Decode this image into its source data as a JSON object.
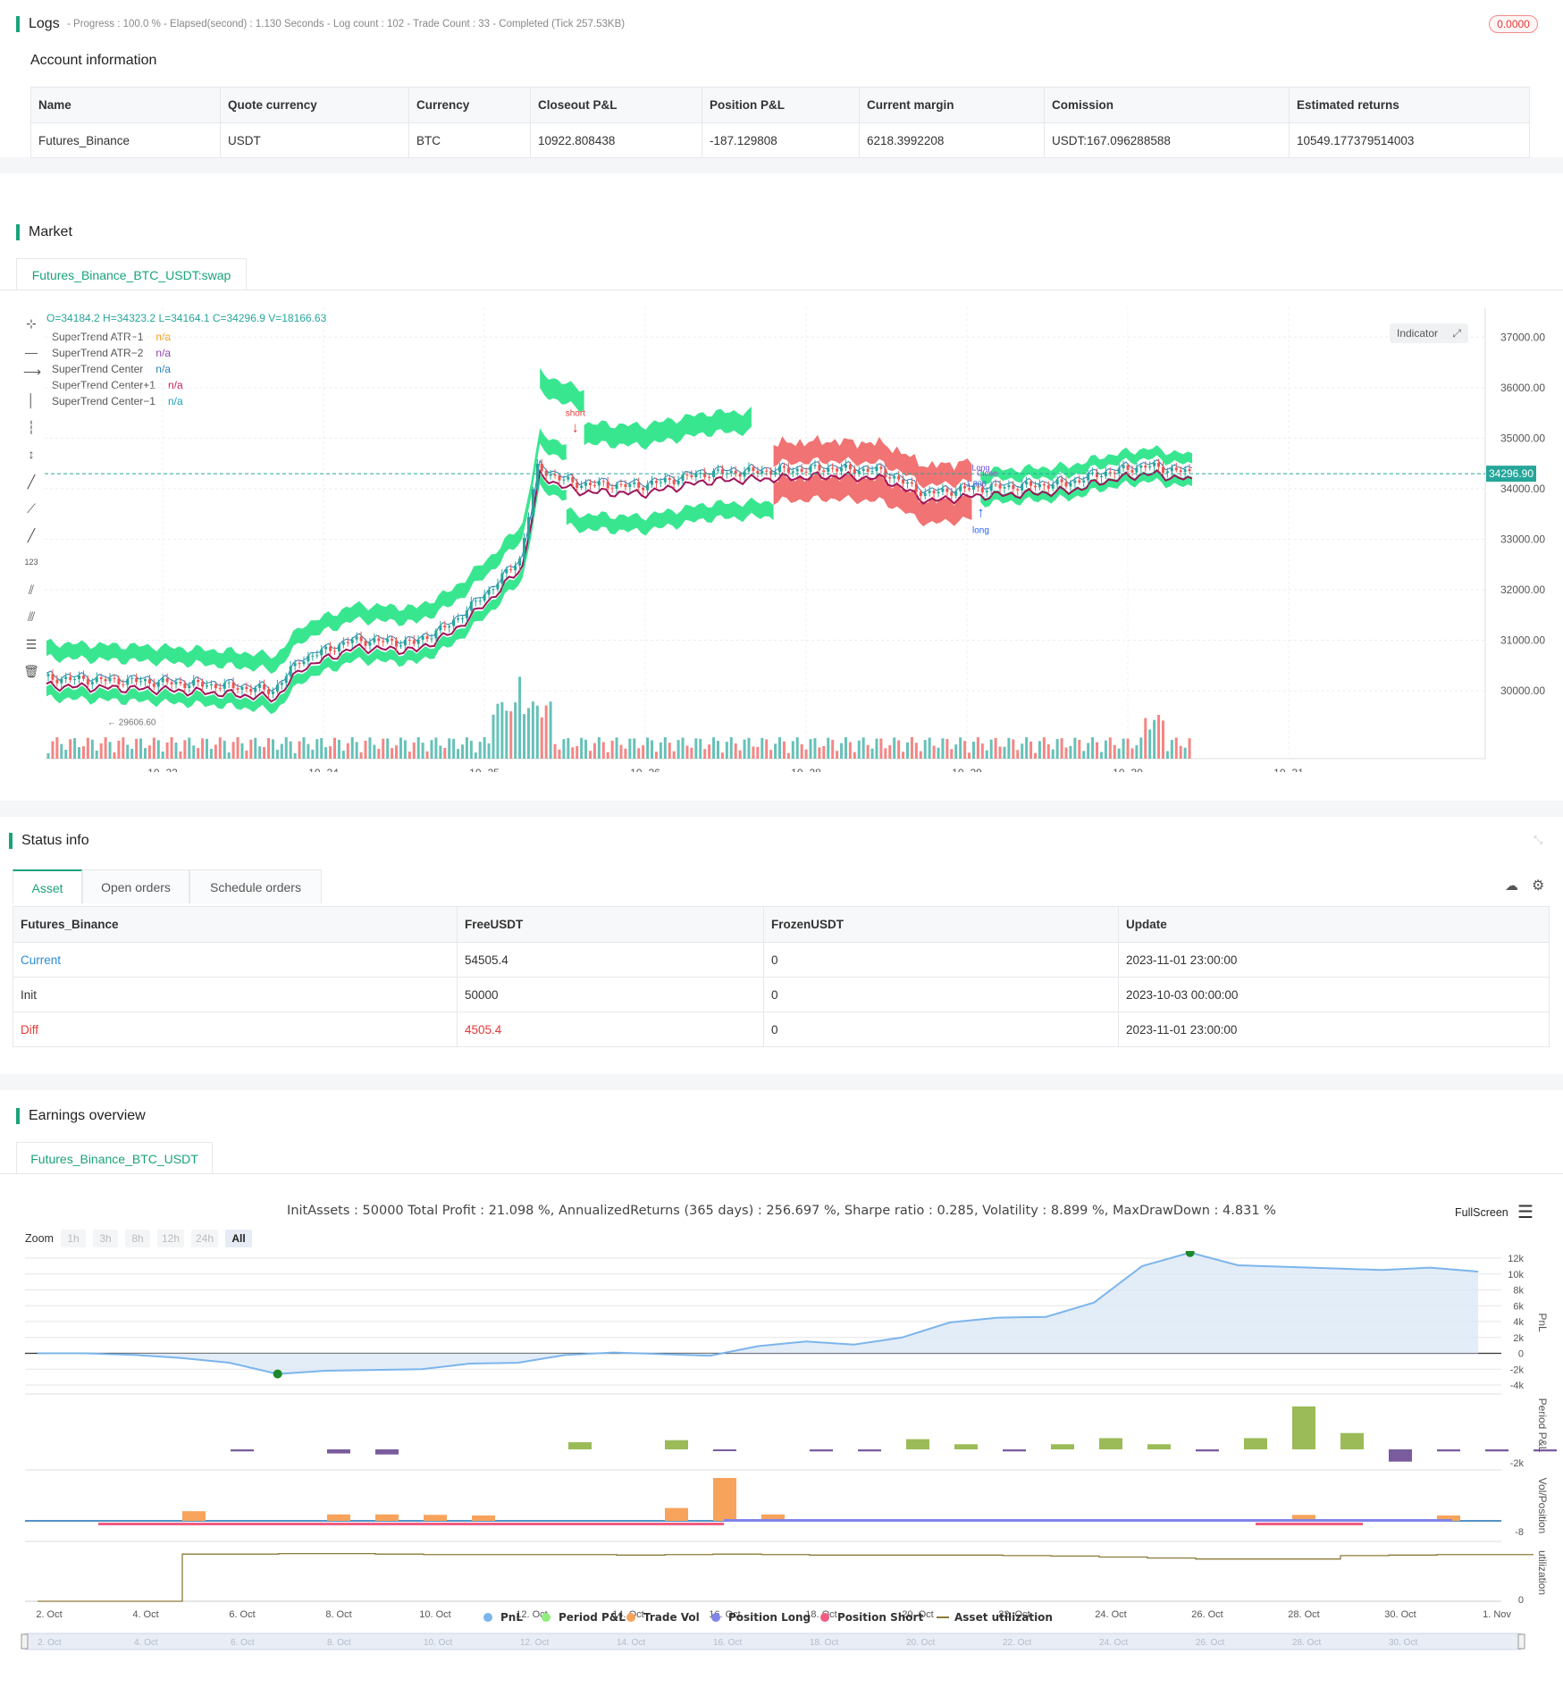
{
  "logs": {
    "title": "Logs",
    "status": "- Progress : 100.0 % - Elapsed(second) : 1.130  Seconds - Log count : 102 - Trade Count : 33 - Completed (Tick 257.53KB)",
    "badge": "0.0000"
  },
  "account": {
    "title": "Account information",
    "headers": [
      "Name",
      "Quote currency",
      "Currency",
      "Closeout P&L",
      "Position P&L",
      "Current margin",
      "Comission",
      "Estimated returns"
    ],
    "row": [
      "Futures_Binance",
      "USDT",
      "BTC",
      "10922.808438",
      "-187.129808",
      "6218.3992208",
      "USDT:167.096288588",
      "10549.177379514003"
    ]
  },
  "market": {
    "title": "Market",
    "tab": "Futures_Binance_BTC_USDT:swap",
    "ohlc": "O=34184.2 H=34323.2 L=34164.1 C=34296.9 V=18166.63",
    "legend": [
      {
        "name": "SuperTrend ATR−1",
        "value": "n/a",
        "color": "#f39c12"
      },
      {
        "name": "SuperTrend ATR−2",
        "value": "n/a",
        "color": "#8e44ad"
      },
      {
        "name": "SuperTrend Center",
        "value": "n/a",
        "color": "#2980b9"
      },
      {
        "name": "SuperTrend Center+1",
        "value": "n/a",
        "color": "#c2185b"
      },
      {
        "name": "SuperTrend Center−1",
        "value": "n/a",
        "color": "#17a2b8"
      }
    ],
    "indicator_button": "Indicator",
    "price_axis": [
      "37000.00",
      "36000.00",
      "35000.00",
      "34000.00",
      "33000.00",
      "32000.00",
      "31000.00",
      "30000.00"
    ],
    "last_price": "34296.90",
    "low_label": "29606.60",
    "time_axis": [
      "10−23",
      "10−24",
      "10−25",
      "10−26",
      "10−28",
      "10−29",
      "10−30",
      "10−31"
    ],
    "markers": {
      "short": "short",
      "long": "long",
      "close_short": "Close",
      "trade_qty": "1.808",
      "long_entry": "Long"
    },
    "colors": {
      "up": "#26a69a",
      "down": "#ef5350",
      "band_green": "#2ee58a",
      "band_red": "#f06b6b"
    }
  },
  "status": {
    "title": "Status info",
    "tabs": [
      "Asset",
      "Open orders",
      "Schedule orders"
    ],
    "headers": [
      "Futures_Binance",
      "FreeUSDT",
      "FrozenUSDT",
      "Update"
    ],
    "rows": [
      [
        "Current",
        "54505.4",
        "0",
        "2023-11-01 23:00:00"
      ],
      [
        "Init",
        "50000",
        "0",
        "2023-10-03 00:00:00"
      ],
      [
        "Diff",
        "4505.4",
        "0",
        "2023-11-01 23:00:00"
      ]
    ]
  },
  "earnings": {
    "title": "Earnings overview",
    "tab": "Futures_Binance_BTC_USDT",
    "summary": "InitAssets : 50000 Total Profit : 21.098 %, AnnualizedReturns (365 days) : 256.697 %, Sharpe ratio : 0.285, Volatility : 8.899 %, MaxDrawDown : 4.831 %",
    "fullscreen": "FullScreen",
    "zoom_label": "Zoom",
    "zoom_options": [
      "1h",
      "3h",
      "8h",
      "12h",
      "24h",
      "All"
    ],
    "pnl_axis": [
      "12k",
      "10k",
      "8k",
      "6k",
      "4k",
      "2k",
      "0",
      "-2k",
      "-4k"
    ],
    "pnl_label": "PnL",
    "period_label": "Period P&L",
    "period_axis": "-2k",
    "volpos_label": "Vol/Position",
    "volpos_axis": "-8",
    "util_label": "utilization",
    "util_axis": "0",
    "x_axis": [
      "2. Oct",
      "4. Oct",
      "6. Oct",
      "8. Oct",
      "10. Oct",
      "12. Oct",
      "14. Oct",
      "16. Oct",
      "18. Oct",
      "20. Oct",
      "22. Oct",
      "24. Oct",
      "26. Oct",
      "28. Oct",
      "30. Oct",
      "1. Nov"
    ],
    "navigator_axis": [
      "2. Oct",
      "4. Oct",
      "6. Oct",
      "8. Oct",
      "10. Oct",
      "12. Oct",
      "14. Oct",
      "16. Oct",
      "18. Oct",
      "20. Oct",
      "22. Oct",
      "24. Oct",
      "26. Oct",
      "28. Oct",
      "30. Oct"
    ],
    "legend": [
      {
        "name": "PnL",
        "color": "#7cb5ec"
      },
      {
        "name": "Period P&L",
        "color": "#90ed7d"
      },
      {
        "name": "Trade Vol",
        "color": "#f7a35c"
      },
      {
        "name": "Position Long",
        "color": "#8085e9"
      },
      {
        "name": "Position Short",
        "color": "#f15c80"
      },
      {
        "name": "Asset utilization",
        "color": "#8d7a3a"
      }
    ],
    "chart_data": {
      "type": "area",
      "x": [
        "2. Oct",
        "3. Oct",
        "4. Oct",
        "5. Oct",
        "6. Oct",
        "7. Oct",
        "8. Oct",
        "9. Oct",
        "10. Oct",
        "11. Oct",
        "12. Oct",
        "13. Oct",
        "14. Oct",
        "15. Oct",
        "16. Oct",
        "17. Oct",
        "18. Oct",
        "19. Oct",
        "20. Oct",
        "21. Oct",
        "22. Oct",
        "23. Oct",
        "24. Oct",
        "25. Oct",
        "26. Oct",
        "27. Oct",
        "28. Oct",
        "29. Oct",
        "30. Oct",
        "31. Oct",
        "1. Nov"
      ],
      "series": [
        {
          "name": "PnL",
          "values": [
            0,
            0,
            -200,
            -600,
            -1200,
            -2600,
            -2200,
            -2100,
            -2000,
            -1300,
            -1200,
            -200,
            100,
            -100,
            -300,
            900,
            1500,
            1100,
            2000,
            3900,
            4500,
            4600,
            6400,
            11000,
            12700,
            11100,
            10900,
            10700,
            10500,
            10800,
            10300
          ]
        }
      ],
      "ylim": [
        -4000,
        12000
      ],
      "max_point": 12700,
      "min_point": -2600
    },
    "period_values": [
      0,
      0,
      -200,
      0,
      -400,
      -500,
      0,
      0,
      0,
      700,
      0,
      900,
      -100,
      0,
      -200,
      -200,
      1000,
      500,
      -200,
      500,
      1100,
      500,
      -200,
      1100,
      4200,
      1600,
      -1200,
      -200,
      -200,
      -200,
      200,
      -500
    ],
    "trade_vol_values": [
      0,
      0,
      4.5,
      0,
      0,
      3,
      3,
      2.8,
      2.5,
      0,
      0,
      0,
      6,
      20,
      3,
      0,
      0,
      0,
      0,
      0,
      0,
      0,
      0,
      0,
      0,
      2.8,
      0,
      0,
      2.5,
      0,
      0,
      0
    ],
    "utilization_steps": [
      0,
      0,
      0,
      96,
      96,
      97,
      97,
      96,
      95,
      95,
      95,
      95,
      94,
      95,
      96,
      95,
      94,
      94,
      94,
      94,
      93,
      92,
      90,
      88,
      86,
      86,
      86,
      93,
      94,
      95,
      95,
      95
    ]
  }
}
